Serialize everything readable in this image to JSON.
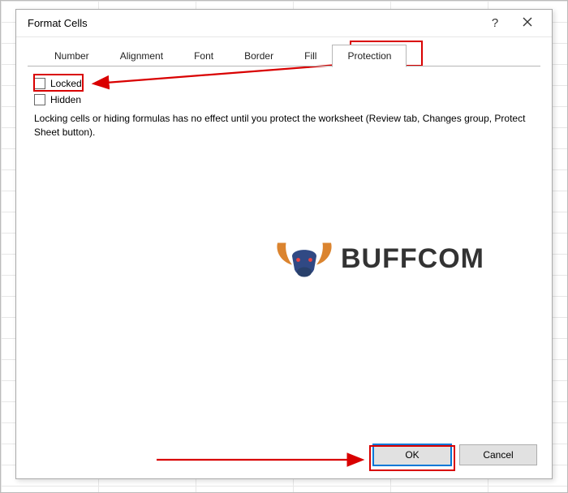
{
  "dialog": {
    "title": "Format Cells",
    "help_tooltip": "?",
    "tabs": [
      {
        "label": "Number"
      },
      {
        "label": "Alignment"
      },
      {
        "label": "Font"
      },
      {
        "label": "Border"
      },
      {
        "label": "Fill"
      },
      {
        "label": "Protection"
      }
    ],
    "active_tab_index": 5,
    "protection": {
      "locked_label": "Locked",
      "locked_checked": false,
      "hidden_label": "Hidden",
      "hidden_checked": false,
      "description": "Locking cells or hiding formulas has no effect until you protect the worksheet (Review tab, Changes group, Protect Sheet button)."
    },
    "buttons": {
      "ok": "OK",
      "cancel": "Cancel"
    }
  },
  "watermark": {
    "brand": "BUFFCOM"
  },
  "annotation_color": "#d90000"
}
